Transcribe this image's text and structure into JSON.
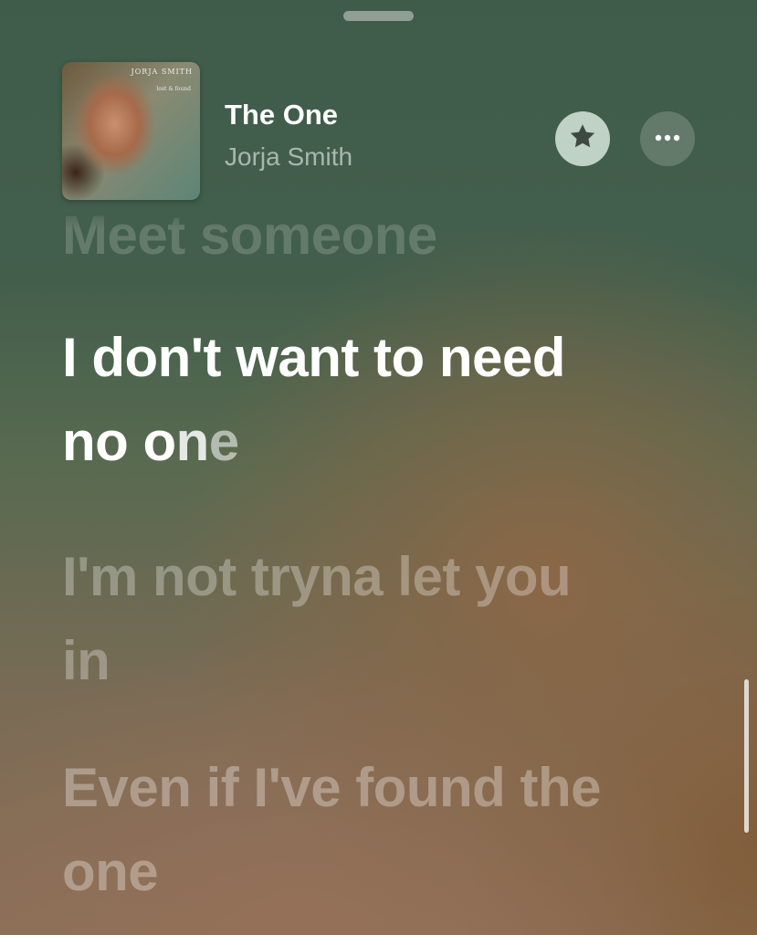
{
  "now_playing": {
    "title": "The One",
    "artist": "Jorja Smith",
    "album_art": {
      "artist_text": "JORJA SMITH",
      "album_text": "lost & found"
    }
  },
  "actions": {
    "favorite_icon": "star-icon",
    "more_icon": "ellipsis-icon"
  },
  "lyrics": {
    "previous_line": "Meet someone",
    "current_line": {
      "line1": "I don't want to need",
      "line2_sung": "no o",
      "line2_mid": "n",
      "line2_rest": "e"
    },
    "next_line_1": {
      "line1": "I'm not tryna let you",
      "line2": "in"
    },
    "next_line_2": {
      "line1": "Even if I've found the",
      "line2": "one"
    }
  },
  "colors": {
    "background_top": "#3f5b4a",
    "background_bottom": "#8b6f58",
    "active_lyric": "#ffffff"
  }
}
